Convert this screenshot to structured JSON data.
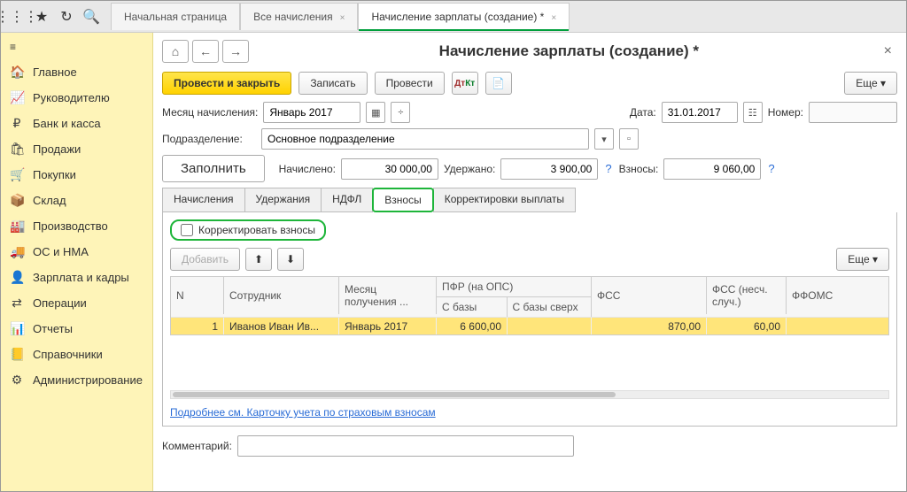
{
  "topTabs": [
    "Начальная страница",
    "Все начисления",
    "Начисление зарплаты (создание) *"
  ],
  "sidebar": {
    "items": [
      {
        "icon": "≡",
        "label": ""
      },
      {
        "icon": "🏠",
        "label": "Главное"
      },
      {
        "icon": "📈",
        "label": "Руководителю"
      },
      {
        "icon": "₽",
        "label": "Банк и касса"
      },
      {
        "icon": "🛍",
        "label": "Продажи"
      },
      {
        "icon": "🛒",
        "label": "Покупки"
      },
      {
        "icon": "📦",
        "label": "Склад"
      },
      {
        "icon": "🏭",
        "label": "Производство"
      },
      {
        "icon": "🚚",
        "label": "ОС и НМА"
      },
      {
        "icon": "👤",
        "label": "Зарплата и кадры"
      },
      {
        "icon": "⇄",
        "label": "Операции"
      },
      {
        "icon": "📊",
        "label": "Отчеты"
      },
      {
        "icon": "📒",
        "label": "Справочники"
      },
      {
        "icon": "⚙",
        "label": "Администрирование"
      }
    ]
  },
  "pageTitle": "Начисление зарплаты (создание) *",
  "toolbar": {
    "primary": "Провести и закрыть",
    "write": "Записать",
    "post": "Провести",
    "more": "Еще ▾"
  },
  "monthRow": {
    "label": "Месяц начисления:",
    "value": "Январь 2017",
    "dateLabel": "Дата:",
    "dateValue": "31.01.2017",
    "numLabel": "Номер:",
    "numValue": ""
  },
  "dept": {
    "label": "Подразделение:",
    "value": "Основное подразделение"
  },
  "fill": {
    "btn": "Заполнить",
    "accr_label": "Начислено:",
    "accr": "30 000,00",
    "ded_label": "Удержано:",
    "ded": "3 900,00",
    "contr_label": "Взносы:",
    "contr": "9 060,00"
  },
  "innerTabs": [
    "Начисления",
    "Удержания",
    "НДФЛ",
    "Взносы",
    "Корректировки выплаты"
  ],
  "correct": "Корректировать взносы",
  "tb2": {
    "add": "Добавить",
    "more": "Еще ▾"
  },
  "grid": {
    "cols": {
      "n": "N",
      "emp": "Сотрудник",
      "mon": "Месяц получения ...",
      "pfr": "ПФР (на ОПС)",
      "pfr1": "С базы",
      "pfr2": "С базы сверх",
      "fss": "ФСС",
      "fss2": "ФСС (несч. случ.)",
      "ffoms": "ФФОМС"
    },
    "rows": [
      {
        "n": "1",
        "emp": "Иванов Иван Ив...",
        "mon": "Январь 2017",
        "pfr1": "6 600,00",
        "pfr2": "",
        "fss": "870,00",
        "fss2": "60,00",
        "ffoms": ""
      }
    ]
  },
  "moreLink": "Подробнее см. Карточку учета по страховым взносам",
  "comment": {
    "label": "Комментарий:",
    "value": ""
  }
}
